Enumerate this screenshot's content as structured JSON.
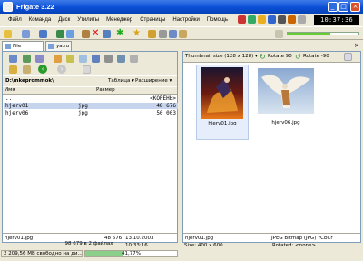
{
  "window": {
    "title": "Frigate 3.22",
    "clock": "10:37:36"
  },
  "menu": [
    "Файл",
    "Команда",
    "Диск",
    "Утилиты",
    "Менеджер",
    "Страницы",
    "Настройки",
    "Помощь"
  ],
  "tabs": [
    {
      "label": "File Manager"
    },
    {
      "label": "ya.ru"
    }
  ],
  "left": {
    "path": "D:\\mkeprommok\\",
    "view_table": "Таблица",
    "view_ext": "Расширение",
    "col_name": "Имя",
    "col_size": "Размер",
    "rows": [
      {
        "name": "..",
        "ext": "",
        "size": "<КОРЕНЬ>"
      },
      {
        "name": "hjerv01",
        "ext": "jpg",
        "size": "48 676"
      },
      {
        "name": "hjerv06",
        "ext": "jpg",
        "size": "50 003"
      }
    ],
    "footer": {
      "file": "hjerv01.jpg",
      "size": "48 676",
      "date": "13.10.2003 10:33:16",
      "total": "98 679 в 2 файлах"
    }
  },
  "right": {
    "thumb_size": "Thumbnail size (128 x 128)",
    "rotate_pos": "Rotate 90",
    "rotate_neg": "Rotate -90",
    "thumbs": [
      {
        "name": "hjerv01.jpg"
      },
      {
        "name": "hjerv06.jpg"
      }
    ],
    "footer": {
      "file": "hjerv01.jpg",
      "type": "JPEG Bitmap (JPG) YCbCr",
      "size": "Size: 400 x 600",
      "rotated": "Rotated: <none>"
    }
  },
  "status": {
    "free": "2 209,56 MB свободно на ди...",
    "progress": "41,77%",
    "progress_value": 41.77
  }
}
